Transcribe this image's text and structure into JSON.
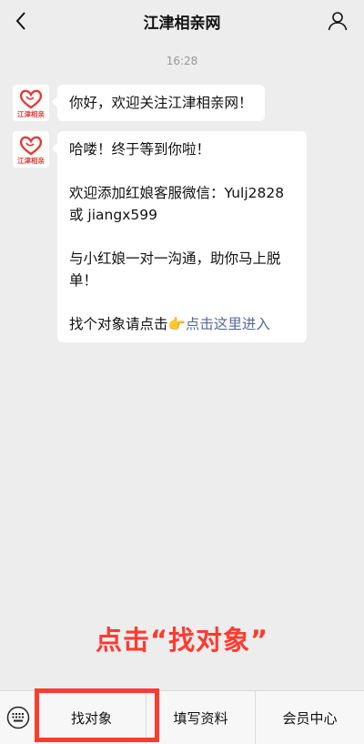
{
  "header": {
    "title": "江津相亲网",
    "back_icon": "chevron-left-icon",
    "profile_icon": "person-icon"
  },
  "chat": {
    "time": "16:28",
    "avatar_label": "江津相亲",
    "messages": [
      {
        "text": "你好，欢迎关注江津相亲网！"
      },
      {
        "line1": "哈喽！终于等到你啦！",
        "line2": "欢迎添加红娘客服微信：Yulj2828或 jiangx599",
        "line3": "与小红娘一对一沟通，助你马上脱单！",
        "line4_prefix": "找个对象请点击",
        "line4_emoji": "👉",
        "line4_link": "点击这里进入"
      }
    ]
  },
  "instruction": "点击“找对象”",
  "bottom_bar": {
    "keyboard_icon": "keyboard-icon",
    "items": [
      {
        "label": "找对象"
      },
      {
        "label": "填写资料"
      },
      {
        "label": "会员中心"
      }
    ]
  },
  "colors": {
    "background": "#ededed",
    "highlight": "#ff3b30",
    "link": "#576b95"
  }
}
